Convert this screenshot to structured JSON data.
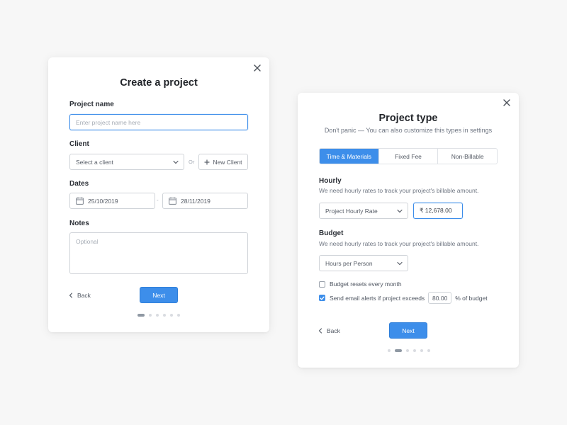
{
  "create_project": {
    "title": "Create a project",
    "project_name_label": "Project name",
    "project_name_placeholder": "Enter project name here",
    "client_label": "Client",
    "client_select_value": "Select a client",
    "or_text": "Or",
    "new_client_label": "New Client",
    "dates_label": "Dates",
    "start_date": "25/10/2019",
    "date_separator": "-",
    "end_date": "28/11/2019",
    "notes_label": "Notes",
    "notes_placeholder": "Optional",
    "back_label": "Back",
    "next_label": "Next",
    "step_dots_total": 6,
    "step_active": 1
  },
  "project_type": {
    "title": "Project type",
    "subtitle": "Don't panic — You can also customize this types in settings",
    "tabs": [
      {
        "label": "Time & Materials",
        "active": true
      },
      {
        "label": "Fixed Fee",
        "active": false
      },
      {
        "label": "Non-Billable",
        "active": false
      }
    ],
    "hourly_label": "Hourly",
    "hourly_help": "We need hourly rates to track your project's billable amount.",
    "hourly_select_value": "Project Hourly Rate",
    "rate_value": "₹ 12,678.00",
    "budget_label": "Budget",
    "budget_help": "We need hourly rates to track your project's billable amount.",
    "budget_select_value": "Hours per Person",
    "budget_resets_label": "Budget resets every month",
    "budget_resets_checked": false,
    "email_alerts_label": "Send email alerts if project exceeds",
    "email_alerts_checked": true,
    "alert_percent_value": "80.00",
    "alert_suffix": "% of budget",
    "back_label": "Back",
    "next_label": "Next",
    "step_dots_total": 6,
    "step_active": 2
  },
  "colors": {
    "accent": "#3d8eea",
    "background": "#f7f7f7",
    "card": "#ffffff",
    "text": "#2a2e35",
    "muted": "#6d7480"
  }
}
